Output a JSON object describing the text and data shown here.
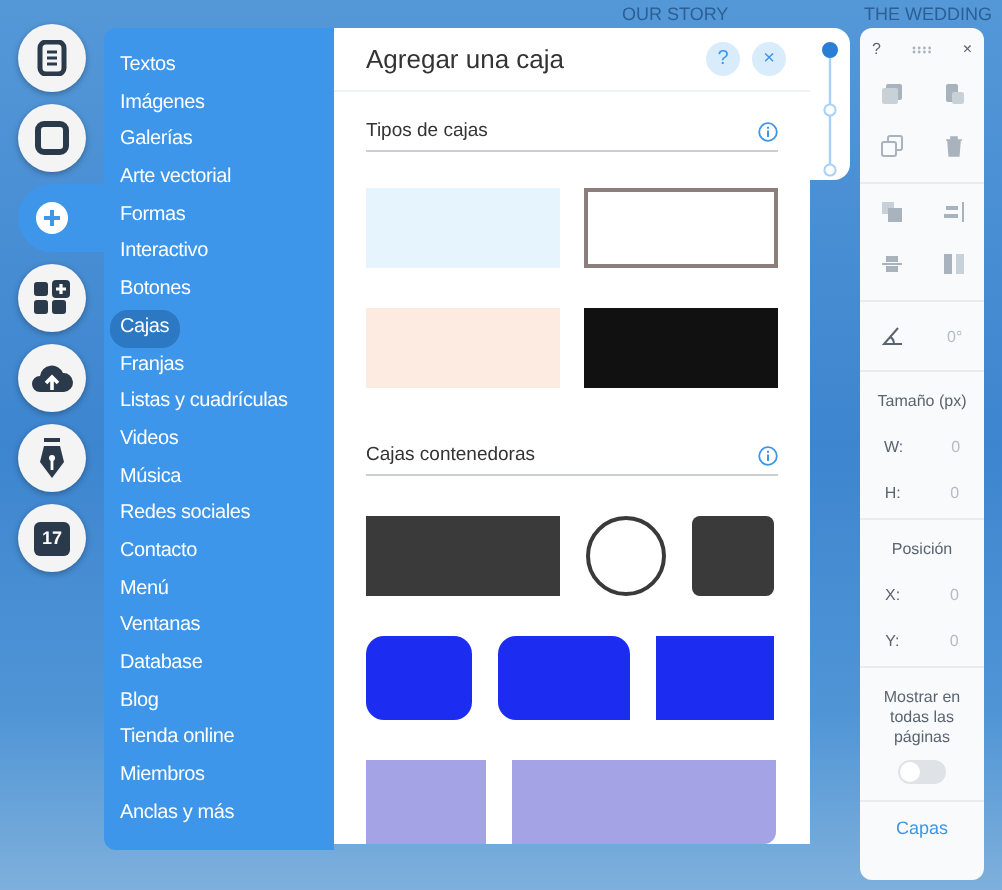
{
  "site_nav": [
    "OUR STORY",
    "THE WEDDING"
  ],
  "rail": [
    {
      "kind": "text",
      "selected": false
    },
    {
      "kind": "box",
      "selected": false
    },
    {
      "kind": "plus",
      "selected": true
    },
    {
      "kind": "apps",
      "selected": false
    },
    {
      "kind": "upload",
      "selected": false
    },
    {
      "kind": "pen",
      "selected": false
    },
    {
      "kind": "calendar",
      "selected": false,
      "badge": "17"
    }
  ],
  "add_menu": {
    "items": [
      {
        "label": "Textos",
        "selected": false
      },
      {
        "label": "Imágenes",
        "selected": false
      },
      {
        "label": "Galerías",
        "selected": false
      },
      {
        "label": "Arte vectorial",
        "selected": false
      },
      {
        "label": "Formas",
        "selected": false
      },
      {
        "label": "Interactivo",
        "selected": false
      },
      {
        "label": "Botones",
        "selected": false
      },
      {
        "label": "Cajas",
        "selected": true
      },
      {
        "label": "Franjas",
        "selected": false
      },
      {
        "label": "Listas y cuadrículas",
        "selected": false
      },
      {
        "label": "Videos",
        "selected": false
      },
      {
        "label": "Música",
        "selected": false
      },
      {
        "label": "Redes sociales",
        "selected": false
      },
      {
        "label": "Contacto",
        "selected": false
      },
      {
        "label": "Menú",
        "selected": false
      },
      {
        "label": "Ventanas",
        "selected": false
      },
      {
        "label": "Database",
        "selected": false
      },
      {
        "label": "Blog",
        "selected": false
      },
      {
        "label": "Tienda online",
        "selected": false
      },
      {
        "label": "Miembros",
        "selected": false
      },
      {
        "label": "Anclas y más",
        "selected": false
      }
    ]
  },
  "panel": {
    "title": "Agregar una caja",
    "help_button": "?",
    "close_button": "×",
    "sections": [
      {
        "title": "Tipos de cajas",
        "kind": "box-types"
      },
      {
        "title": "Cajas contenedoras",
        "kind": "containers"
      }
    ]
  },
  "stepper": [
    {
      "selected": true
    },
    {
      "selected": false
    },
    {
      "selected": false
    }
  ],
  "inspector": {
    "help_button": "?",
    "close_button": "×",
    "angle": "0°",
    "size": {
      "title": "Tamaño (px)",
      "fields": [
        {
          "label": "W:",
          "value": "0"
        },
        {
          "label": "H:",
          "value": "0"
        }
      ]
    },
    "position": {
      "title": "Posición",
      "fields": [
        {
          "label": "X:",
          "value": "0"
        },
        {
          "label": "Y:",
          "value": "0"
        }
      ]
    },
    "show_on_all_pages": {
      "label": "Mostrar en todas las páginas",
      "on": false
    },
    "layers_button": "Capas"
  }
}
